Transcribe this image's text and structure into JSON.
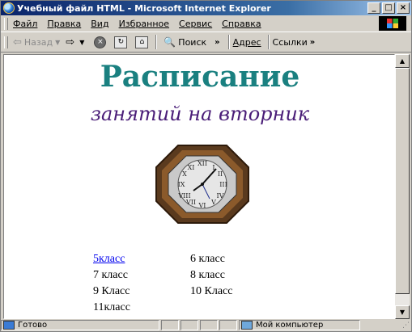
{
  "window": {
    "title": "Учебный файл HTML - Microsoft Internet Explorer"
  },
  "menu": [
    {
      "label": "Файл"
    },
    {
      "label": "Правка"
    },
    {
      "label": "Вид"
    },
    {
      "label": "Избранное"
    },
    {
      "label": "Сервис"
    },
    {
      "label": "Справка"
    }
  ],
  "toolbar": {
    "back": "Назад",
    "search": "Поиск",
    "address": "Адрес",
    "links": "Ссылки"
  },
  "page": {
    "title": "Расписание",
    "subtitle": "занятий на вторник",
    "classes": [
      [
        "5класс",
        "6 класс"
      ],
      [
        "7 класс",
        "8 класс"
      ],
      [
        "9 Класс",
        "10 Класс"
      ],
      [
        "11класс",
        ""
      ]
    ]
  },
  "status": {
    "text": "Готово",
    "zone": "Мой компьютер"
  }
}
